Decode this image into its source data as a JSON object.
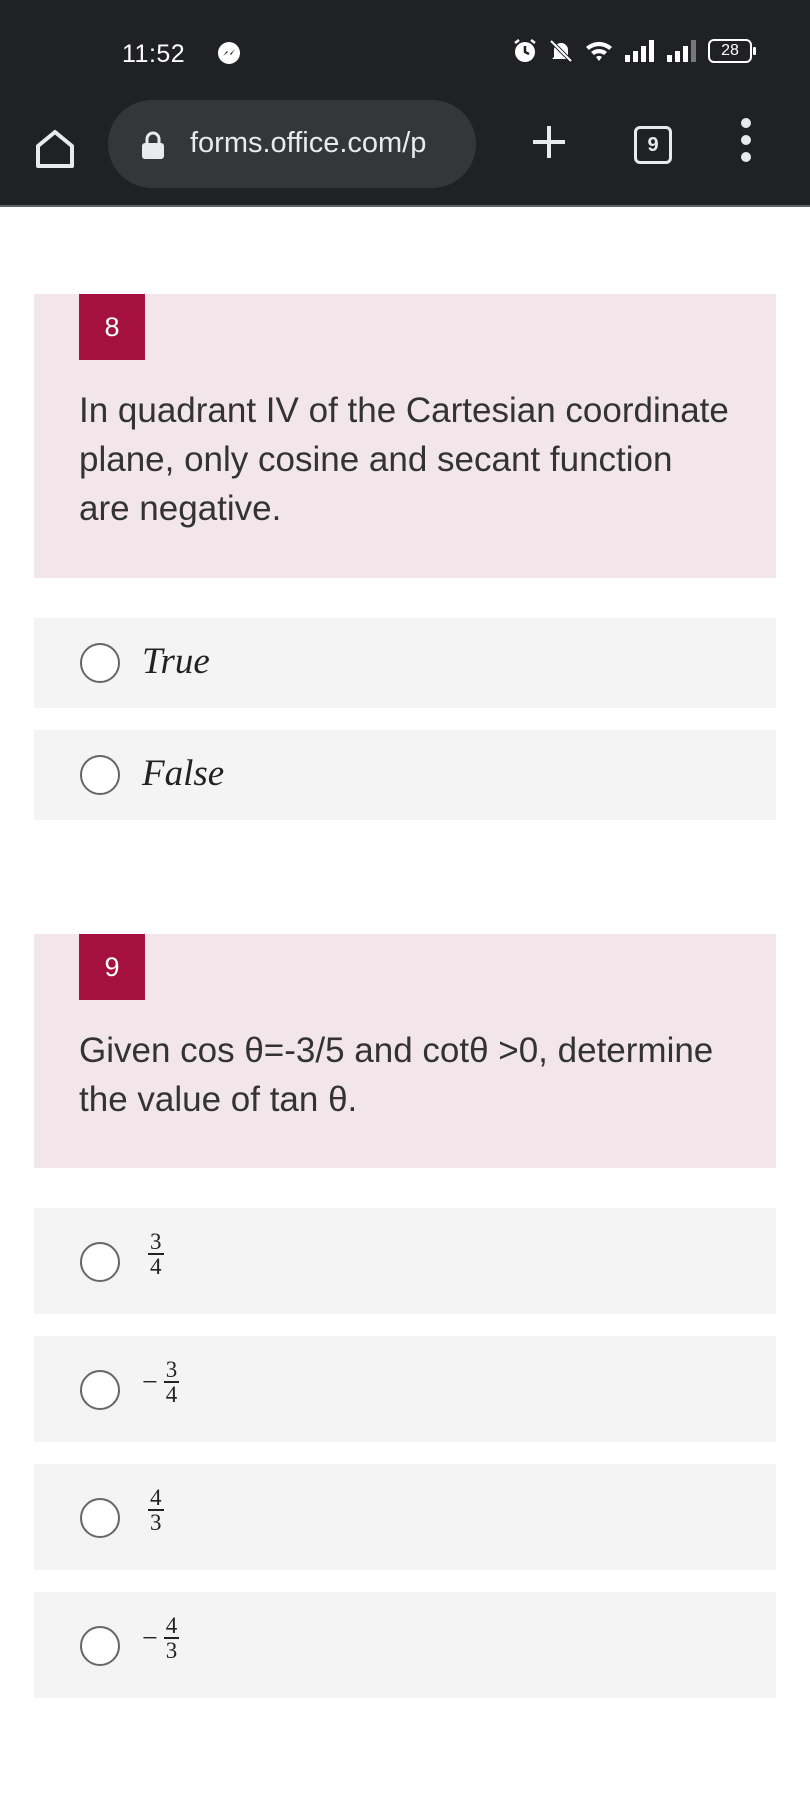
{
  "status_bar": {
    "time": "11:52",
    "battery": "28"
  },
  "browser": {
    "url": "forms.office.com/p",
    "tab_count": "9"
  },
  "questions": [
    {
      "number": "8",
      "text": "In quadrant IV of the Cartesian coordinate plane, only cosine and secant function are negative.",
      "options": [
        "True",
        "False"
      ]
    },
    {
      "number": "9",
      "text": "Given cos θ=-3/5  and  cotθ >0, determine the value of tan θ.",
      "options": [
        {
          "sign": "",
          "numerator": "3",
          "denominator": "4"
        },
        {
          "sign": "−",
          "numerator": "3",
          "denominator": "4"
        },
        {
          "sign": "",
          "numerator": "4",
          "denominator": "3"
        },
        {
          "sign": "−",
          "numerator": "4",
          "denominator": "3"
        }
      ]
    }
  ],
  "colors": {
    "status_bg": "#202124",
    "question_bg": "#f2e6ea",
    "number_badge": "#a4113e",
    "option_bg": "#f4f4f4"
  },
  "icons": [
    "messenger-icon",
    "alarm-icon",
    "mute-icon",
    "wifi-icon",
    "signal-icon",
    "battery-icon",
    "home-icon",
    "lock-icon",
    "plus-icon",
    "tabs-icon",
    "more-vert-icon",
    "radio-icon"
  ]
}
